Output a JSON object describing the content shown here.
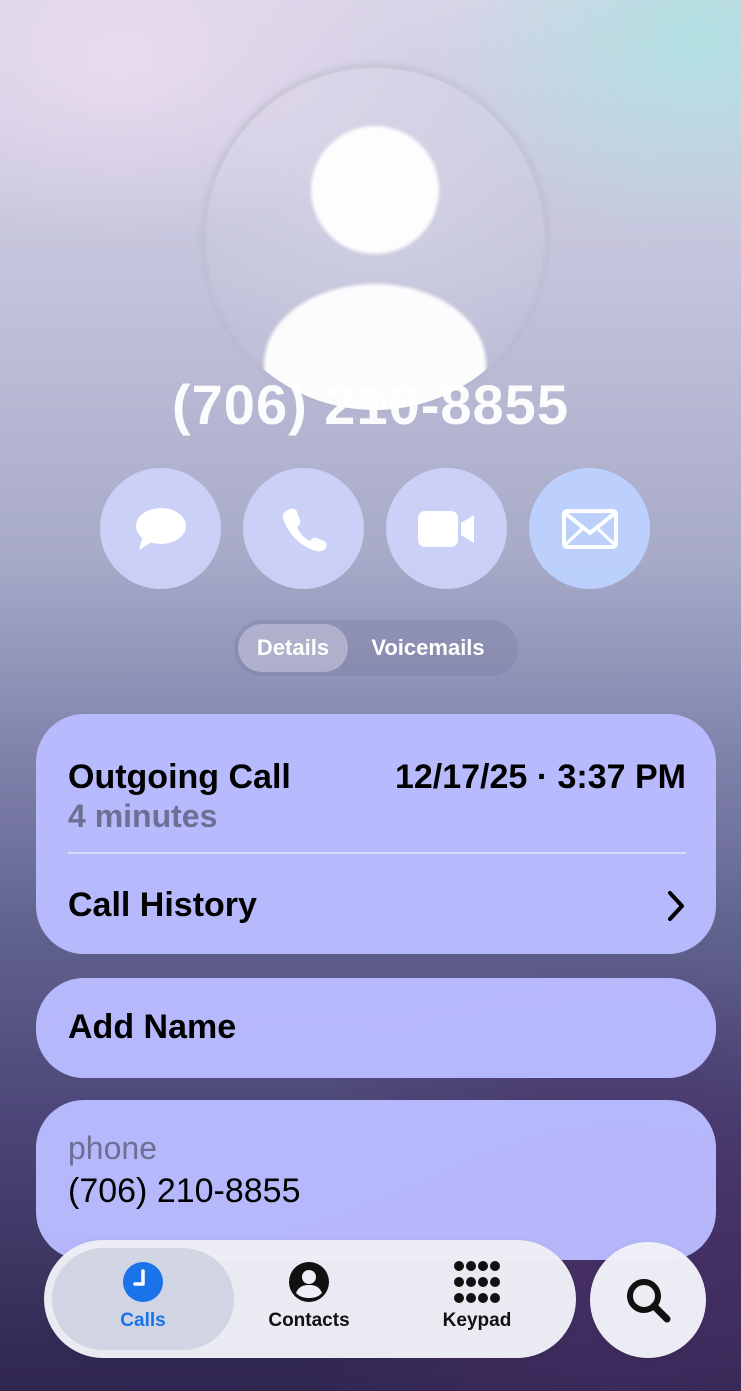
{
  "header": {
    "avatar_label": "UNKNOWN",
    "phone_title": "(706) 210-8855"
  },
  "actions": [
    {
      "icon": "message-icon"
    },
    {
      "icon": "phone-icon"
    },
    {
      "icon": "video-icon"
    },
    {
      "icon": "mail-icon"
    }
  ],
  "segments": {
    "details": "Details",
    "voicemails": "Voicemails",
    "selected": "Details"
  },
  "recent_call": {
    "type": "Outgoing Call",
    "timestamp": "12/17/25 · 3:37 PM",
    "duration": "4 minutes",
    "history_label": "Call History"
  },
  "add_name": {
    "label": "Add Name"
  },
  "phone_field": {
    "label": "phone",
    "value": "(706) 210-8855"
  },
  "tabbar": {
    "calls": "Calls",
    "contacts": "Contacts",
    "keypad": "Keypad",
    "active": "Calls",
    "active_color": "#1a73e8"
  },
  "search": {
    "icon": "search-icon"
  }
}
